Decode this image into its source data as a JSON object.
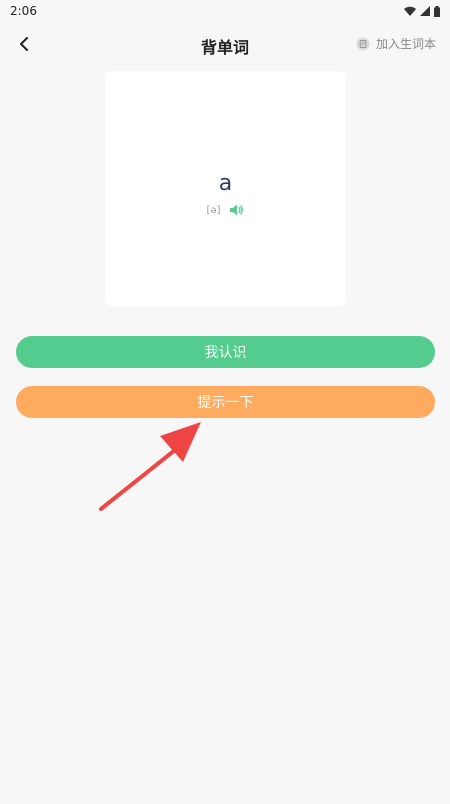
{
  "status": {
    "time": "2:06"
  },
  "nav": {
    "title": "背单词",
    "add_vocab_label": "加入生词本"
  },
  "card": {
    "word": "a",
    "phonetic": "[ə]"
  },
  "buttons": {
    "know_label": "我认识",
    "hint_label": "提示一下"
  },
  "colors": {
    "know": "#53cc8d",
    "hint": "#ffab5f",
    "arrow": "#f04545",
    "speaker": "#53cc8d"
  },
  "icons": [
    "back-arrow-icon",
    "book-icon",
    "speaker-icon",
    "wifi-icon",
    "signal-icon",
    "battery-icon"
  ]
}
